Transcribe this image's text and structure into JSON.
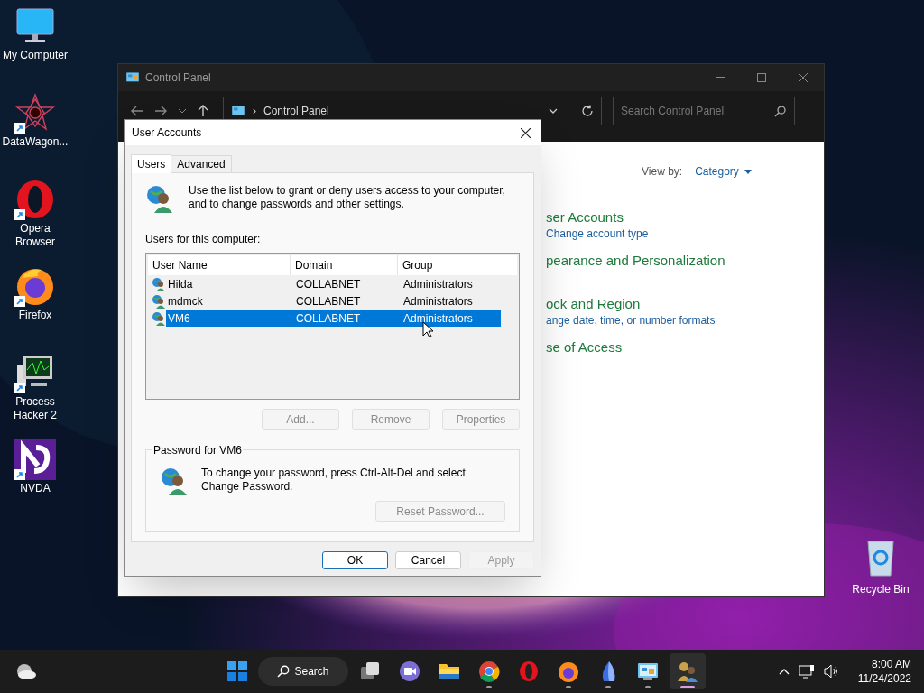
{
  "desktop_icons": [
    {
      "label": "My Computer",
      "kind": "monitor",
      "shortcut": false
    },
    {
      "label": "DataWagon...",
      "kind": "star",
      "shortcut": true
    },
    {
      "label": "Opera Browser",
      "kind": "opera",
      "shortcut": true
    },
    {
      "label": "Firefox",
      "kind": "firefox",
      "shortcut": true
    },
    {
      "label": "Process Hacker 2",
      "kind": "process",
      "shortcut": true
    },
    {
      "label": "NVDA",
      "kind": "nvda",
      "shortcut": true
    }
  ],
  "recycle_bin": {
    "label": "Recycle Bin"
  },
  "control_panel": {
    "title": "Control Panel",
    "address_separator": "›",
    "address": "Control Panel",
    "search": {
      "placeholder": "Search Control Panel"
    },
    "view_by": {
      "label": "View by:",
      "value": "Category"
    },
    "categories": [
      {
        "heading": "ser Accounts",
        "links": [
          "Change account type"
        ]
      },
      {
        "heading": "pearance and Personalization"
      },
      {
        "heading": "ock and Region",
        "links": [
          "ange date, time, or number formats"
        ]
      },
      {
        "heading": "se of Access"
      }
    ]
  },
  "dialog": {
    "title": "User Accounts",
    "tabs": [
      {
        "label": "Users",
        "selected": true
      },
      {
        "label": "Advanced",
        "selected": false
      }
    ],
    "intro": "Use the list below to grant or deny users access to your computer, and to change passwords and other settings.",
    "list_label": "Users for this computer:",
    "columns": [
      "User Name",
      "Domain",
      "Group"
    ],
    "rows": [
      {
        "cells": [
          "Hilda",
          "COLLABNET",
          "Administrators"
        ],
        "selected": false
      },
      {
        "cells": [
          "mdmck",
          "COLLABNET",
          "Administrators"
        ],
        "selected": false
      },
      {
        "cells": [
          "VM6",
          "COLLABNET",
          "Administrators"
        ],
        "selected": true
      }
    ],
    "list_buttons": [
      {
        "label": "Add...",
        "disabled": true
      },
      {
        "label": "Remove",
        "disabled": true
      },
      {
        "label": "Properties",
        "disabled": true
      }
    ],
    "password_group": {
      "title": "Password for VM6",
      "text": "To change your password, press Ctrl-Alt-Del and select Change Password.",
      "button": {
        "label": "Reset Password...",
        "disabled": true
      }
    },
    "buttons": [
      {
        "label": "OK",
        "disabled": false,
        "default": true
      },
      {
        "label": "Cancel",
        "disabled": false,
        "default": false
      },
      {
        "label": "Apply",
        "disabled": true,
        "default": false
      }
    ]
  },
  "taskbar": {
    "search_label": "Search",
    "apps": [
      {
        "kind": "taskview",
        "running": false,
        "selected": false
      },
      {
        "kind": "chat",
        "running": false,
        "selected": false
      },
      {
        "kind": "folder",
        "running": false,
        "selected": false
      },
      {
        "kind": "chrome",
        "running": true,
        "selected": false
      },
      {
        "kind": "opera",
        "running": false,
        "selected": false
      },
      {
        "kind": "firefox",
        "running": true,
        "selected": false
      },
      {
        "kind": "sail",
        "running": true,
        "selected": false
      },
      {
        "kind": "controlpanel",
        "running": true,
        "selected": false
      },
      {
        "kind": "users",
        "running": true,
        "selected": true
      }
    ],
    "clock": {
      "time": "8:00 AM",
      "date": "11/24/2022"
    }
  }
}
